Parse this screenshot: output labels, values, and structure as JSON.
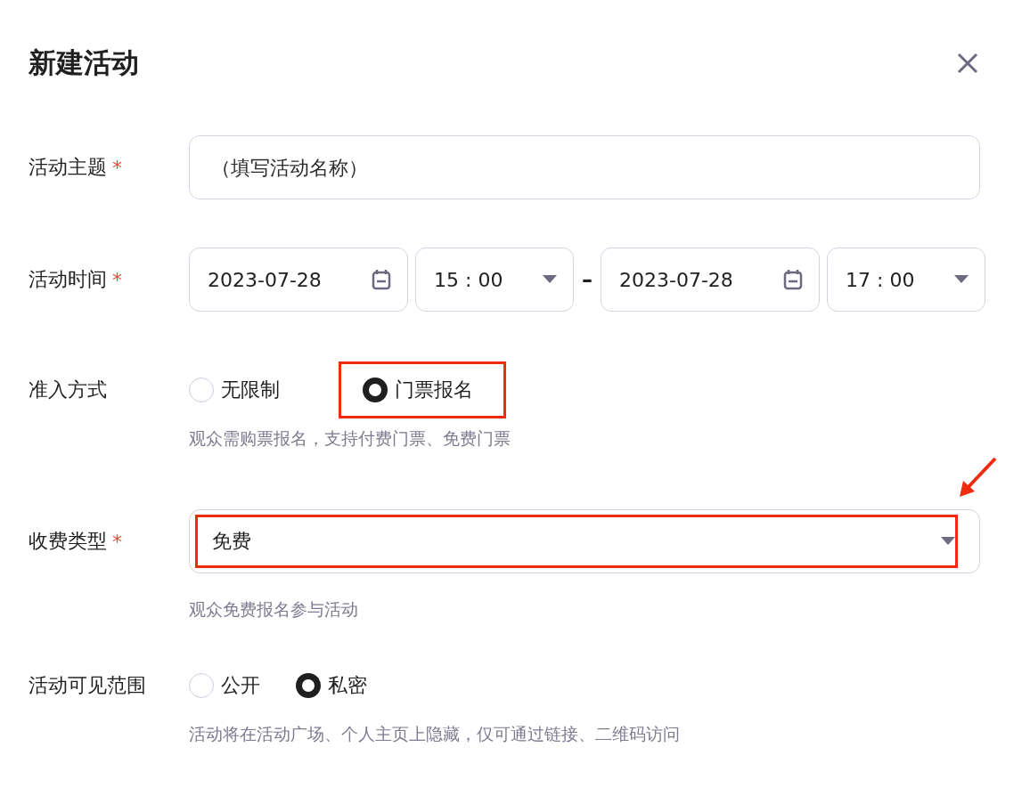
{
  "dialog": {
    "title": "新建活动"
  },
  "fields": [
    {
      "kind": "text",
      "label": "活动主题",
      "required_mark": "*",
      "placeholder": "（填写活动名称）"
    },
    {
      "kind": "datetime",
      "label": "活动时间",
      "required_mark": "*",
      "start_date": "2023-07-28",
      "start_time": "15 : 00",
      "separator": "–",
      "end_date": "2023-07-28",
      "end_time": "17 : 00"
    },
    {
      "kind": "radio",
      "label": "准入方式",
      "options": [
        {
          "label": "无限制",
          "selected": false,
          "highlighted": false
        },
        {
          "label": "门票报名",
          "selected": true,
          "highlighted": true
        }
      ],
      "hint": "观众需购票报名，支持付费门票、免费门票"
    },
    {
      "kind": "select",
      "label": "收费类型",
      "required_mark": "*",
      "value": "免费",
      "highlighted": true,
      "hint": "观众免费报名参与活动"
    },
    {
      "kind": "radio",
      "label": "活动可见范围",
      "options": [
        {
          "label": "公开",
          "selected": false,
          "highlighted": false
        },
        {
          "label": "私密",
          "selected": true,
          "highlighted": false
        }
      ],
      "hint": "活动将在活动广场、个人主页上隐藏，仅可通过链接、二维码访问"
    }
  ]
}
